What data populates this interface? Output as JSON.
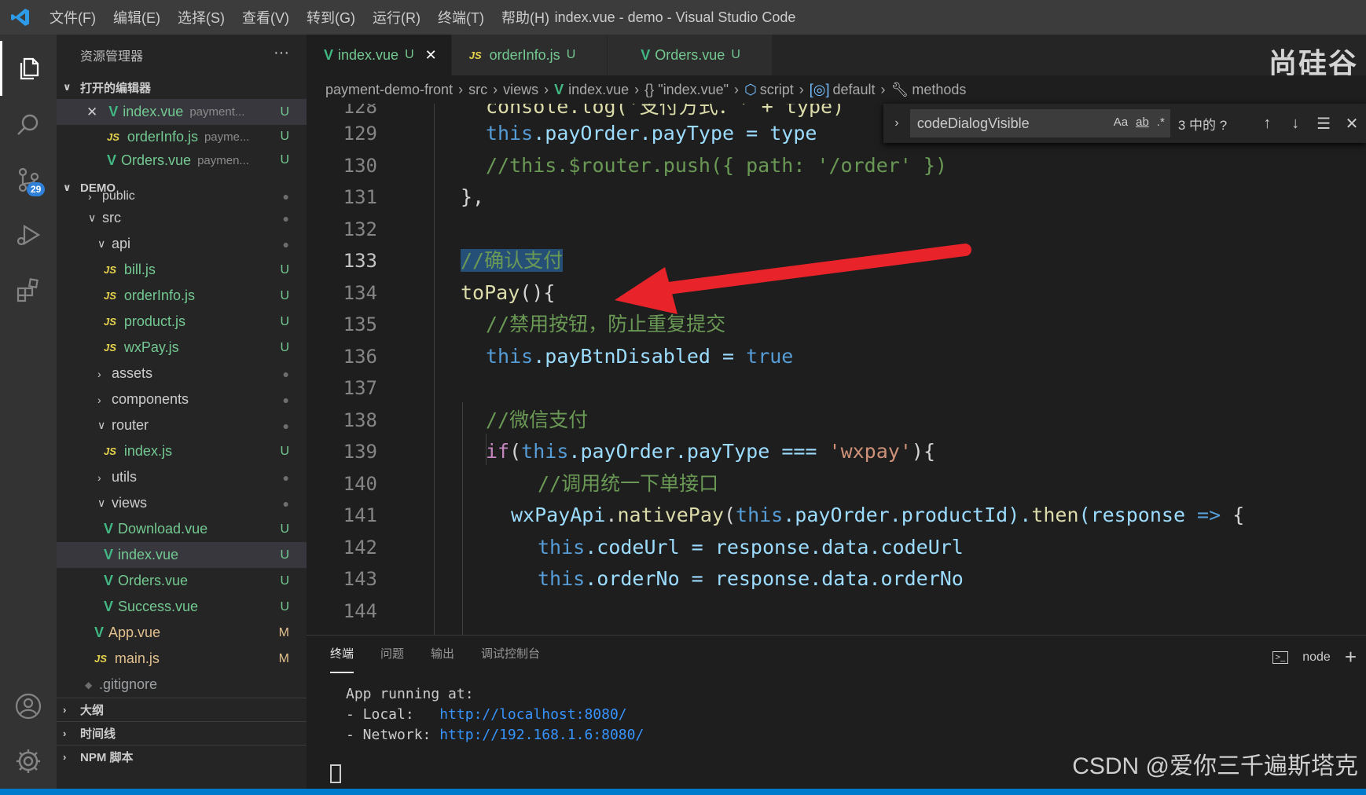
{
  "titlebar": {
    "menu": [
      "文件(F)",
      "编辑(E)",
      "选择(S)",
      "查看(V)",
      "转到(G)",
      "运行(R)",
      "终端(T)",
      "帮助(H)"
    ],
    "window_title": "index.vue - demo - Visual Studio Code"
  },
  "activity": {
    "scm_badge": "29"
  },
  "sidebar": {
    "title": "资源管理器",
    "more": "···",
    "open_editors_label": "打开的编辑器",
    "open_editors": [
      {
        "name": "index.vue",
        "desc": "payment...",
        "status": "U"
      },
      {
        "name": "orderInfo.js",
        "desc": "payme...",
        "status": "U"
      },
      {
        "name": "Orders.vue",
        "desc": "paymen...",
        "status": "U"
      }
    ],
    "workspace_label": "DEMO",
    "tree": [
      {
        "name": "public",
        "status": "●"
      },
      {
        "name": "src",
        "status": "●"
      },
      {
        "name": "api",
        "status": "●"
      },
      {
        "name": "bill.js",
        "status": "U"
      },
      {
        "name": "orderInfo.js",
        "status": "U"
      },
      {
        "name": "product.js",
        "status": "U"
      },
      {
        "name": "wxPay.js",
        "status": "U"
      },
      {
        "name": "assets",
        "status": "●"
      },
      {
        "name": "components",
        "status": "●"
      },
      {
        "name": "router",
        "status": "●"
      },
      {
        "name": "index.js",
        "status": "U"
      },
      {
        "name": "utils",
        "status": "●"
      },
      {
        "name": "views",
        "status": "●"
      },
      {
        "name": "Download.vue",
        "status": "U"
      },
      {
        "name": "index.vue",
        "status": "U"
      },
      {
        "name": "Orders.vue",
        "status": "U"
      },
      {
        "name": "Success.vue",
        "status": "U"
      },
      {
        "name": "App.vue",
        "status": "M"
      },
      {
        "name": "main.js",
        "status": "M"
      },
      {
        "name": ".gitignore",
        "status": ""
      }
    ],
    "outline_label": "大纲",
    "timeline_label": "时间线",
    "npm_label": "NPM 脚本"
  },
  "tabs": [
    {
      "label": "index.vue",
      "status": "U",
      "active": true
    },
    {
      "label": "orderInfo.js",
      "status": "U",
      "active": false
    },
    {
      "label": "Orders.vue",
      "status": "U",
      "active": false
    }
  ],
  "watermark_top": "尚硅谷",
  "breadcrumb": [
    "payment-demo-front",
    "src",
    "views",
    "index.vue",
    "{} \"index.vue\"",
    "script",
    "default",
    "methods"
  ],
  "find": {
    "query": "codeDialogVisible",
    "opt_case": "Aa",
    "opt_word": "ab",
    "opt_regex": ".*",
    "count": "3 中的 ?"
  },
  "editor": {
    "current_line": "133",
    "line_numbers": [
      "128",
      "129",
      "130",
      "131",
      "132",
      "133",
      "134",
      "135",
      "136",
      "137",
      "138",
      "139",
      "140",
      "141",
      "142",
      "143",
      "144"
    ],
    "code": {
      "l128": "console.log('支付方式：' + type)",
      "l129_kw": "this",
      "l129_rest": ".payOrder.payType = ",
      "l129_val": "type",
      "l130": "//this.$router.push({ path: '/order' })",
      "l131": "},",
      "l133": "//确认支付",
      "l134_fn": "toPay",
      "l134_rest": "(){",
      "l135": "//禁用按钮，防止重复提交",
      "l136_kw": "this",
      "l136_rest": ".payBtnDisabled = ",
      "l136_val": "true",
      "l138": "//微信支付",
      "l139_if": "if",
      "l139_a": "(",
      "l139_kw": "this",
      "l139_b": ".payOrder.payType === ",
      "l139_str": "'wxpay'",
      "l139_c": "){",
      "l140": "//调用统一下单接口",
      "l141_obj": "wxPayApi",
      "l141_dot": ".",
      "l141_fn": "nativePay",
      "l141_a": "(",
      "l141_kw": "this",
      "l141_b": ".payOrder.productId).",
      "l141_then": "then",
      "l141_c": "(response ",
      "l141_arrow": "=>",
      "l141_d": " {",
      "l142_kw": "this",
      "l142_rest": ".codeUrl = response.data.codeUrl",
      "l143_kw": "this",
      "l143_rest": ".orderNo = response.data.orderNo"
    }
  },
  "panel": {
    "tabs": [
      "终端",
      "问题",
      "输出",
      "调试控制台"
    ],
    "terminal_name": "node",
    "add": "+",
    "line1": "App running at:",
    "line2_label": "- Local:   ",
    "line2_url": "http://localhost:8080/",
    "line3_label": "- Network: ",
    "line3_url": "http://192.168.1.6:8080/"
  },
  "watermark_bottom": "CSDN @爱你三千遍斯塔克",
  "colors": {
    "accent": "#007acc",
    "annotation": "#e8232a",
    "untracked": "#73c991",
    "modified": "#e2c08d"
  }
}
